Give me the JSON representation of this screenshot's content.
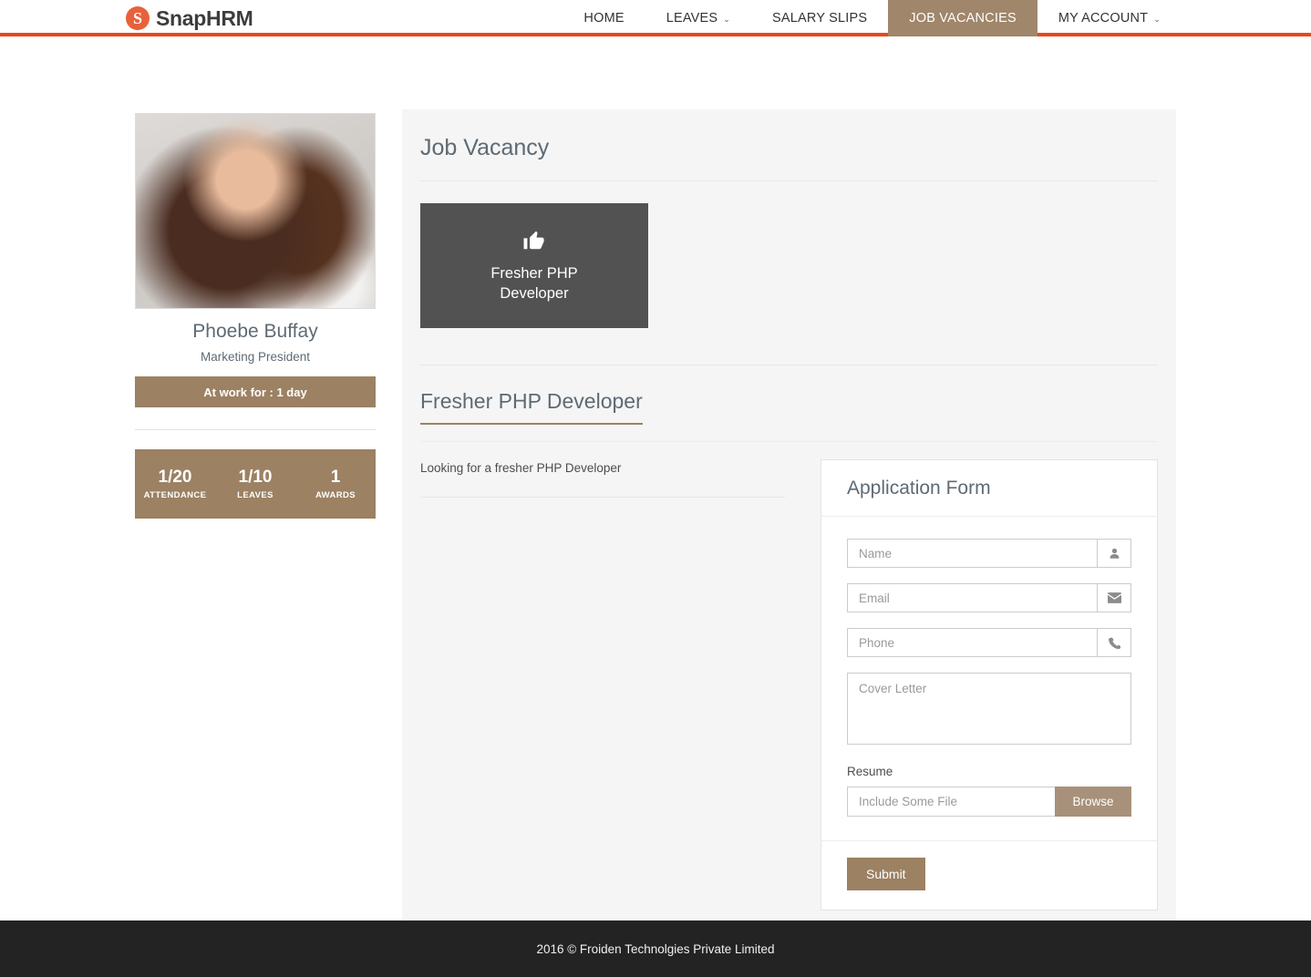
{
  "header": {
    "brand": {
      "mark": "S",
      "name": "SnapHRM",
      "accent_color": "#e8491d"
    },
    "nav": [
      {
        "label": "HOME",
        "name": "home",
        "active": false,
        "caret": false
      },
      {
        "label": "LEAVES",
        "name": "leaves",
        "active": false,
        "caret": true
      },
      {
        "label": "SALARY SLIPS",
        "name": "salary-slips",
        "active": false,
        "caret": false
      },
      {
        "label": "JOB VACANCIES",
        "name": "job-vacancies",
        "active": true,
        "caret": false
      },
      {
        "label": "MY ACCOUNT",
        "name": "my-account",
        "active": false,
        "caret": true
      }
    ],
    "caret_glyph": "⌄"
  },
  "sidebar": {
    "avatar_alt": "Phoebe Buffay profile photo",
    "name": "Phoebe Buffay",
    "role": "Marketing President",
    "work_status": "At work for : 1 day",
    "stats": [
      {
        "value": "1/20",
        "label": "ATTENDANCE"
      },
      {
        "value": "1/10",
        "label": "LEAVES"
      },
      {
        "value": "1",
        "label": "AWARDS"
      }
    ]
  },
  "content": {
    "panel_title": "Job Vacancy",
    "vacancies": [
      {
        "label": "Fresher PHP\nDeveloper",
        "icon": "👍",
        "selected": true
      }
    ],
    "job": {
      "heading": "Fresher PHP Developer",
      "description": "Looking for a fresher PHP Developer"
    },
    "form": {
      "title": "Application Form",
      "fields": [
        {
          "name": "name",
          "placeholder": "Name",
          "value": "",
          "icon": "user-icon",
          "glyph": "👤"
        },
        {
          "name": "email",
          "placeholder": "Email",
          "value": "",
          "icon": "envelope-icon",
          "glyph": "✉"
        },
        {
          "name": "phone",
          "placeholder": "Phone",
          "value": "",
          "icon": "phone-icon",
          "glyph": "✆"
        }
      ],
      "cover_letter": {
        "placeholder": "Cover Letter",
        "value": ""
      },
      "resume_label": "Resume",
      "resume_file": {
        "placeholder": "Include Some File",
        "value": ""
      },
      "browse_label": "Browse",
      "submit_label": "Submit"
    }
  },
  "footer": {
    "text": "2016 © Froiden Technolgies Private Limited"
  },
  "colors": {
    "accent_orange": "#e8491d",
    "brand_brown": "#9c8163",
    "nav_active": "#a0866a",
    "card_dark": "#525252",
    "panel_bg": "#f5f5f5",
    "footer_bg": "#232323"
  }
}
